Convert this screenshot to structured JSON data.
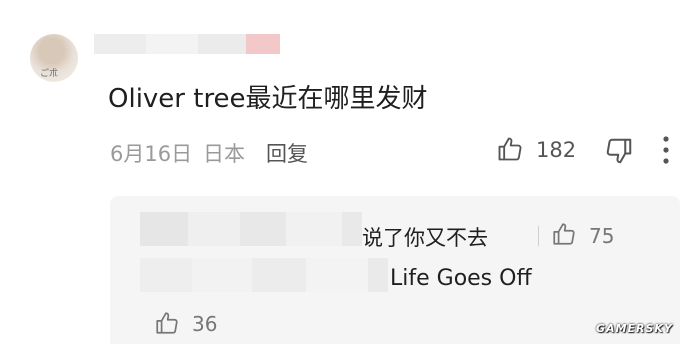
{
  "comment": {
    "text": "Oliver tree最近在哪里发财",
    "date": "6月16日",
    "location": "日本",
    "reply_label": "回复",
    "like_count": "182",
    "avatar_mark": "ご朮"
  },
  "replies": [
    {
      "text": "说了你又不去",
      "like_count": "75"
    },
    {
      "text": "Life Goes Off"
    }
  ],
  "bottom_like_count": "36",
  "watermark": "GAMERSKY",
  "icons": [
    "thumbs-up-icon",
    "thumbs-down-icon",
    "more-vertical-icon"
  ]
}
